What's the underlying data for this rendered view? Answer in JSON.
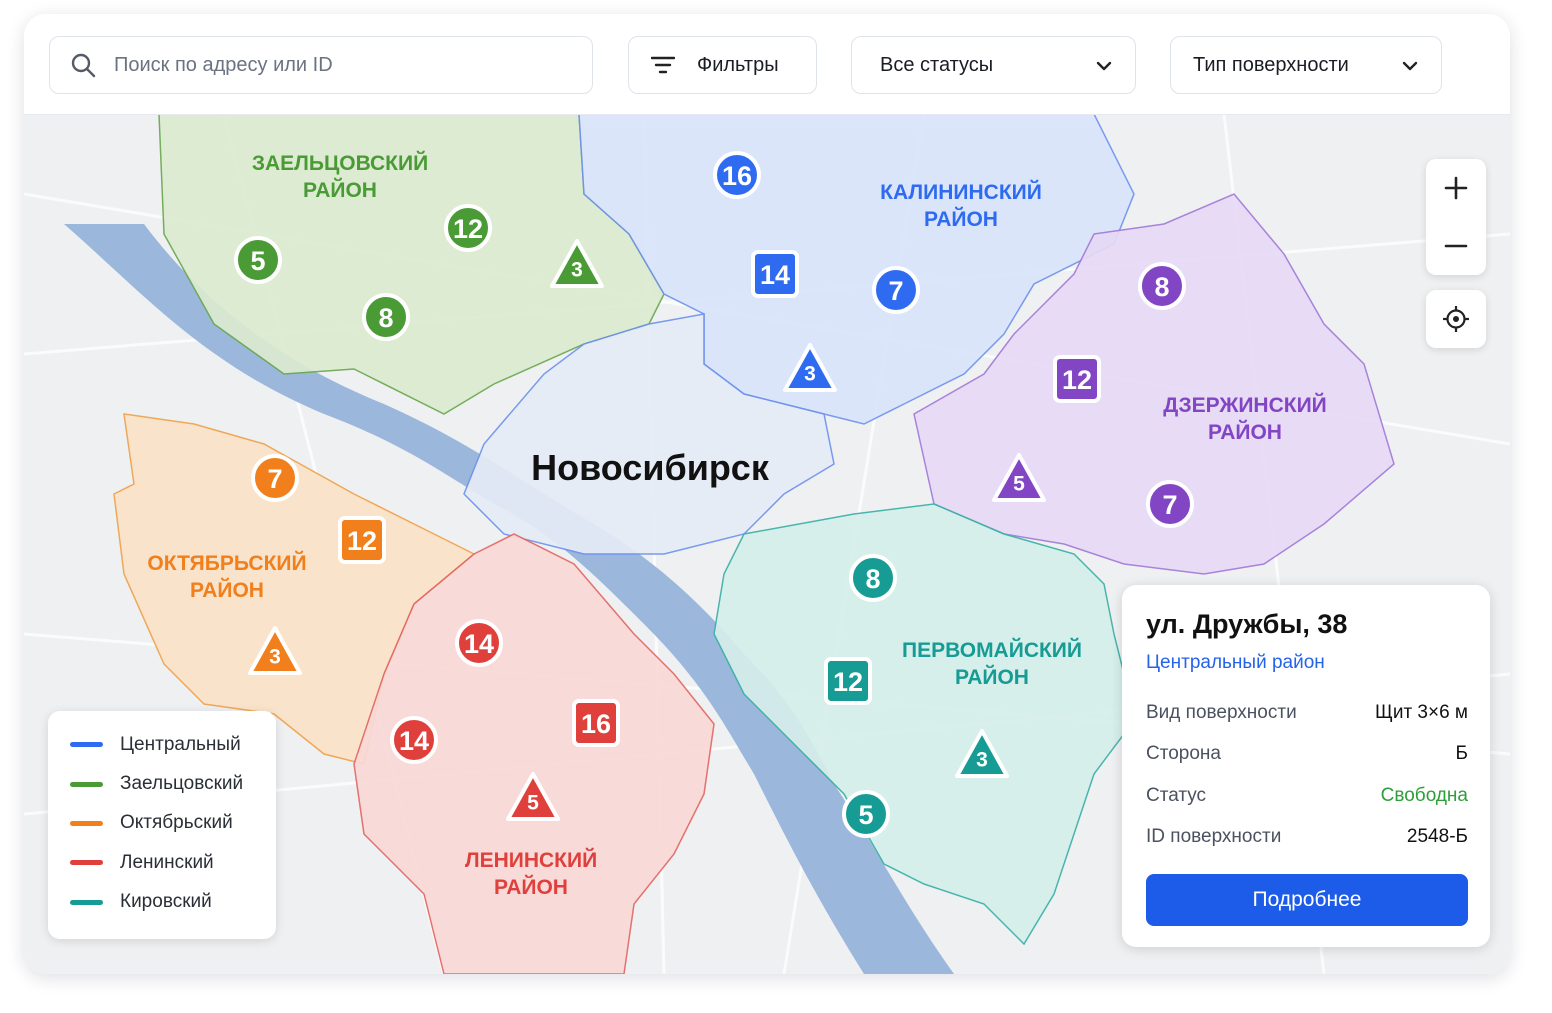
{
  "toolbar": {
    "search_placeholder": "Поиск по адресу или ID",
    "filters_label": "Фильтры",
    "status_dropdown": "Все статусы",
    "surface_dropdown": "Тип поверхности"
  },
  "colors": {
    "central": "#2f6bf0",
    "zaeltsovsky": "#4a9a35",
    "oktyabrsky": "#f07f1c",
    "leninsky": "#e0403c",
    "kirovsky": "#169c94",
    "dzerzhinsky": "#8245c4",
    "accent": "#1d5ce8",
    "status_free": "#2e9e3a"
  },
  "map": {
    "city": "Новосибирск",
    "districts": [
      {
        "id": "zaeltsovsky",
        "line1": "ЗАЕЛЬЦОВСКИЙ",
        "line2": "РАЙОН"
      },
      {
        "id": "kalininsky",
        "line1": "КАЛИНИНСКИЙ",
        "line2": "РАЙОН"
      },
      {
        "id": "dzerzhinsky",
        "line1": "ДЗЕРЖИНСКИЙ",
        "line2": "РАЙОН"
      },
      {
        "id": "oktyabrsky",
        "line1": "ОКТЯБРЬСКИЙ",
        "line2": "РАЙОН"
      },
      {
        "id": "pervomaysky",
        "line1": "ПЕРВОМАЙСКИЙ",
        "line2": "РАЙОН"
      },
      {
        "id": "leninsky",
        "line1": "ЛЕНИНСКИЙ",
        "line2": "РАЙОН"
      }
    ],
    "markers": {
      "z1": "5",
      "z2": "12",
      "z3": "3",
      "z4": "8",
      "k1": "16",
      "k2": "14",
      "k3": "7",
      "k4": "3",
      "d1": "8",
      "d2": "12",
      "d3": "5",
      "d4": "7",
      "o1": "7",
      "o2": "12",
      "o3": "3",
      "p1": "8",
      "p2": "12",
      "p3": "3",
      "p4": "5",
      "l1": "14",
      "l2": "14",
      "l3": "16",
      "l4": "5"
    }
  },
  "legend": [
    {
      "label": "Центральный",
      "color": "#2f6bf0"
    },
    {
      "label": "Заельцовский",
      "color": "#4a9a35"
    },
    {
      "label": "Октябрьский",
      "color": "#f07f1c"
    },
    {
      "label": "Ленинский",
      "color": "#e0403c"
    },
    {
      "label": "Кировский",
      "color": "#169c94"
    }
  ],
  "info": {
    "address": "ул. Дружбы, 38",
    "district": "Центральный район",
    "rows": [
      {
        "key": "Вид поверхности",
        "value": "Щит 3×6 м"
      },
      {
        "key": "Сторона",
        "value": "Б"
      },
      {
        "key": "Статус",
        "value": "Свободна"
      },
      {
        "key": "ID поверхности",
        "value": "2548-Б"
      }
    ],
    "button": "Подробнее"
  }
}
